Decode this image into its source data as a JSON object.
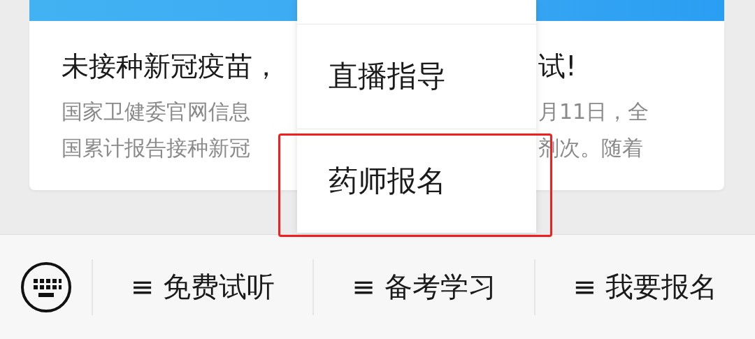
{
  "card": {
    "title_parts": [
      "未接种新冠疫苗，",
      "试!"
    ],
    "summary_lines": [
      {
        "left": "国家卫健委官网信息",
        "right": "月11日，全"
      },
      {
        "left": "国累计报告接种新冠",
        "right": "剂次。随着"
      }
    ]
  },
  "popup_menu": {
    "items": [
      "直播指导",
      "药师报名"
    ]
  },
  "bottom_menu": {
    "items": [
      "≡ 免费试听",
      "≡ 备考学习",
      "≡ 我要报名"
    ]
  }
}
